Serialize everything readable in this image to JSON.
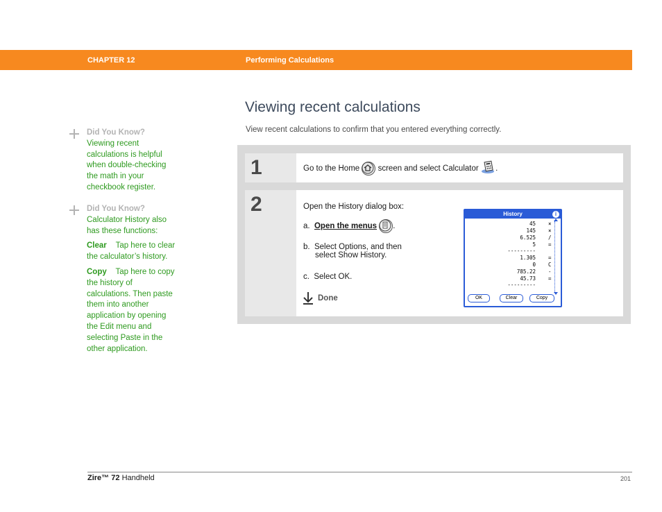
{
  "header": {
    "chapter": "CHAPTER 12",
    "chapter_title": "Performing Calculations",
    "bar_color": "#f7891f"
  },
  "page_title": "Viewing recent calculations",
  "intro": "View recent calculations to confirm that you entered everything correctly.",
  "sidebar": {
    "tip1": {
      "heading": "Did You Know?",
      "lines": [
        "Viewing recent",
        "calculations is helpful",
        "when double-checking",
        "the math in your",
        "checkbook register."
      ]
    },
    "tip2": {
      "heading": "Did You Know?",
      "lines": [
        "Calculator History also",
        "has these functions:"
      ],
      "clear_term": "Clear",
      "clear_lines": [
        "Tap here to clear",
        "the calculator’s history."
      ],
      "copy_term": "Copy",
      "copy_lines": [
        "Tap here to copy",
        "the history of",
        "calculations. Then paste",
        "them into another",
        "application by opening",
        "the Edit menu and",
        "selecting Paste in the",
        "other application."
      ]
    }
  },
  "steps": {
    "step1": {
      "number": "1",
      "text_before": "Go to the Home",
      "text_middle": "screen and select Calculator",
      "text_after": ".",
      "home_icon": "home-icon",
      "calc_icon": "calculator-icon"
    },
    "step2": {
      "number": "2",
      "intro": "Open the History dialog box:",
      "a_prefix": "a.",
      "a_link": "Open the menus",
      "a_suffix": ".",
      "menu_icon": "menu-icon",
      "b_prefix": "b.",
      "b_line1": "Select Options, and then",
      "b_line2": "select Show History.",
      "c_prefix": "c.",
      "c_text": "Select OK.",
      "done": "Done"
    }
  },
  "history_dialog": {
    "title": "History",
    "info": "i",
    "rows": [
      {
        "value": "45",
        "op": "×"
      },
      {
        "value": "145",
        "op": "×"
      },
      {
        "value": "6.525",
        "op": "/"
      },
      {
        "value": "5",
        "op": "="
      },
      {
        "value": "---------",
        "op": ""
      },
      {
        "value": "1.305",
        "op": "="
      },
      {
        "value": "0",
        "op": "C"
      },
      {
        "value": "785.22",
        "op": "-"
      },
      {
        "value": "45.73",
        "op": "="
      },
      {
        "value": "---------",
        "op": ""
      }
    ],
    "buttons": {
      "ok": "OK",
      "clear": "Clear",
      "copy": "Copy"
    },
    "accent": "#2a5bd7"
  },
  "footer": {
    "product_brand": "Zire™",
    "product_model": "72",
    "product_suffix": "Handheld",
    "page": "201"
  }
}
